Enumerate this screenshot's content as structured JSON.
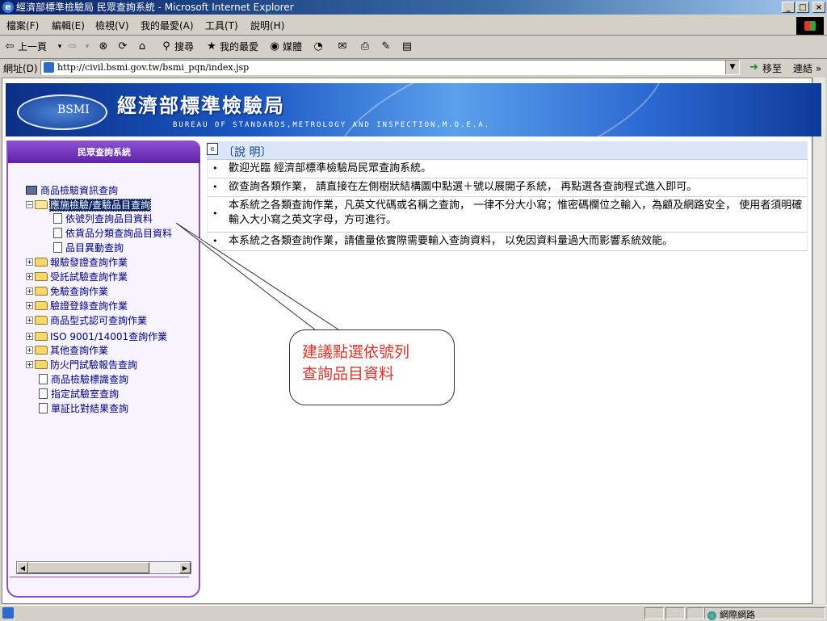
{
  "window": {
    "title": "經濟部標準檢驗局 民眾查詢系統 - Microsoft Internet Explorer",
    "controls": {
      "minimize": "_",
      "maximize": "□",
      "close": "×"
    }
  },
  "menu": [
    "檔案(F)",
    "編輯(E)",
    "檢視(V)",
    "我的最愛(A)",
    "工具(T)",
    "說明(H)"
  ],
  "toolbar": {
    "back": "上一頁",
    "search": "搜尋",
    "favorites": "我的最愛",
    "media": "媒體"
  },
  "address": {
    "label": "網址(D)",
    "url": "http://civil.bsmi.gov.tw/bsmi_pqn/index.jsp",
    "go": "移至",
    "links": "連結"
  },
  "banner": {
    "logo": "BSMI",
    "title": "經濟部標準檢驗局",
    "subtitle": "BUREAU OF STANDARDS,METROLOGY AND INSPECTION,M.O.E.A."
  },
  "sidebar": {
    "title": "民眾查詢系統",
    "root": "商品檢驗資訊查詢",
    "items": [
      {
        "label": "應施檢驗/查驗品目查詢",
        "expanded": true,
        "selected": true
      },
      {
        "label": "依號列查詢品目資料"
      },
      {
        "label": "依貨品分類查詢品目資料"
      },
      {
        "label": "品目異動查詢"
      },
      {
        "label": "報驗發證查詢作業"
      },
      {
        "label": "受託試驗查詢作業"
      },
      {
        "label": "免驗查詢作業"
      },
      {
        "label": "驗證登錄查詢作業"
      },
      {
        "label": "商品型式認可查詢作業"
      },
      {
        "label": "ISO 9001/14001查詢作業"
      },
      {
        "label": "其他查詢作業"
      },
      {
        "label": "防火門試驗報告查詢"
      },
      {
        "label": "商品檢驗標識查詢"
      },
      {
        "label": "指定試驗室查詢"
      },
      {
        "label": "單証比對結果查詢"
      }
    ]
  },
  "info": {
    "heading": "〔說 明〕",
    "bullet": "•",
    "rows": [
      "歡迎光臨 經濟部標準檢驗局民眾查詢系統。",
      "欲查詢各類作業， 請直接在左側樹狀結構圖中點選＋號以展開子系統， 再點選各查詢程式進入即可。",
      "本系統之各類查詢作業，凡英文代碼或名稱之查詢， 一律不分大小寫；惟密碼欄位之輸入，為顧及網路安全， 使用者須明確輸入大小寫之英文字母，方可進行。",
      "本系統之各類查詢作業，請儘量依實際需要輸入查詢資料， 以免因資料量過大而影響系統效能。"
    ]
  },
  "callout": {
    "line1": "建議點選依號列",
    "line2": "查詢品目資料"
  },
  "status": {
    "zone": "網際網路"
  },
  "icons": {
    "back": "back-arrow-icon",
    "forward": "forward-arrow-icon",
    "stop": "stop-icon",
    "refresh": "refresh-icon",
    "home": "home-icon",
    "search": "search-icon",
    "favorites": "favorites-icon",
    "media": "media-icon",
    "history": "history-icon",
    "mail": "mail-icon",
    "print": "print-icon",
    "edit": "edit-icon",
    "discuss": "discuss-icon"
  }
}
